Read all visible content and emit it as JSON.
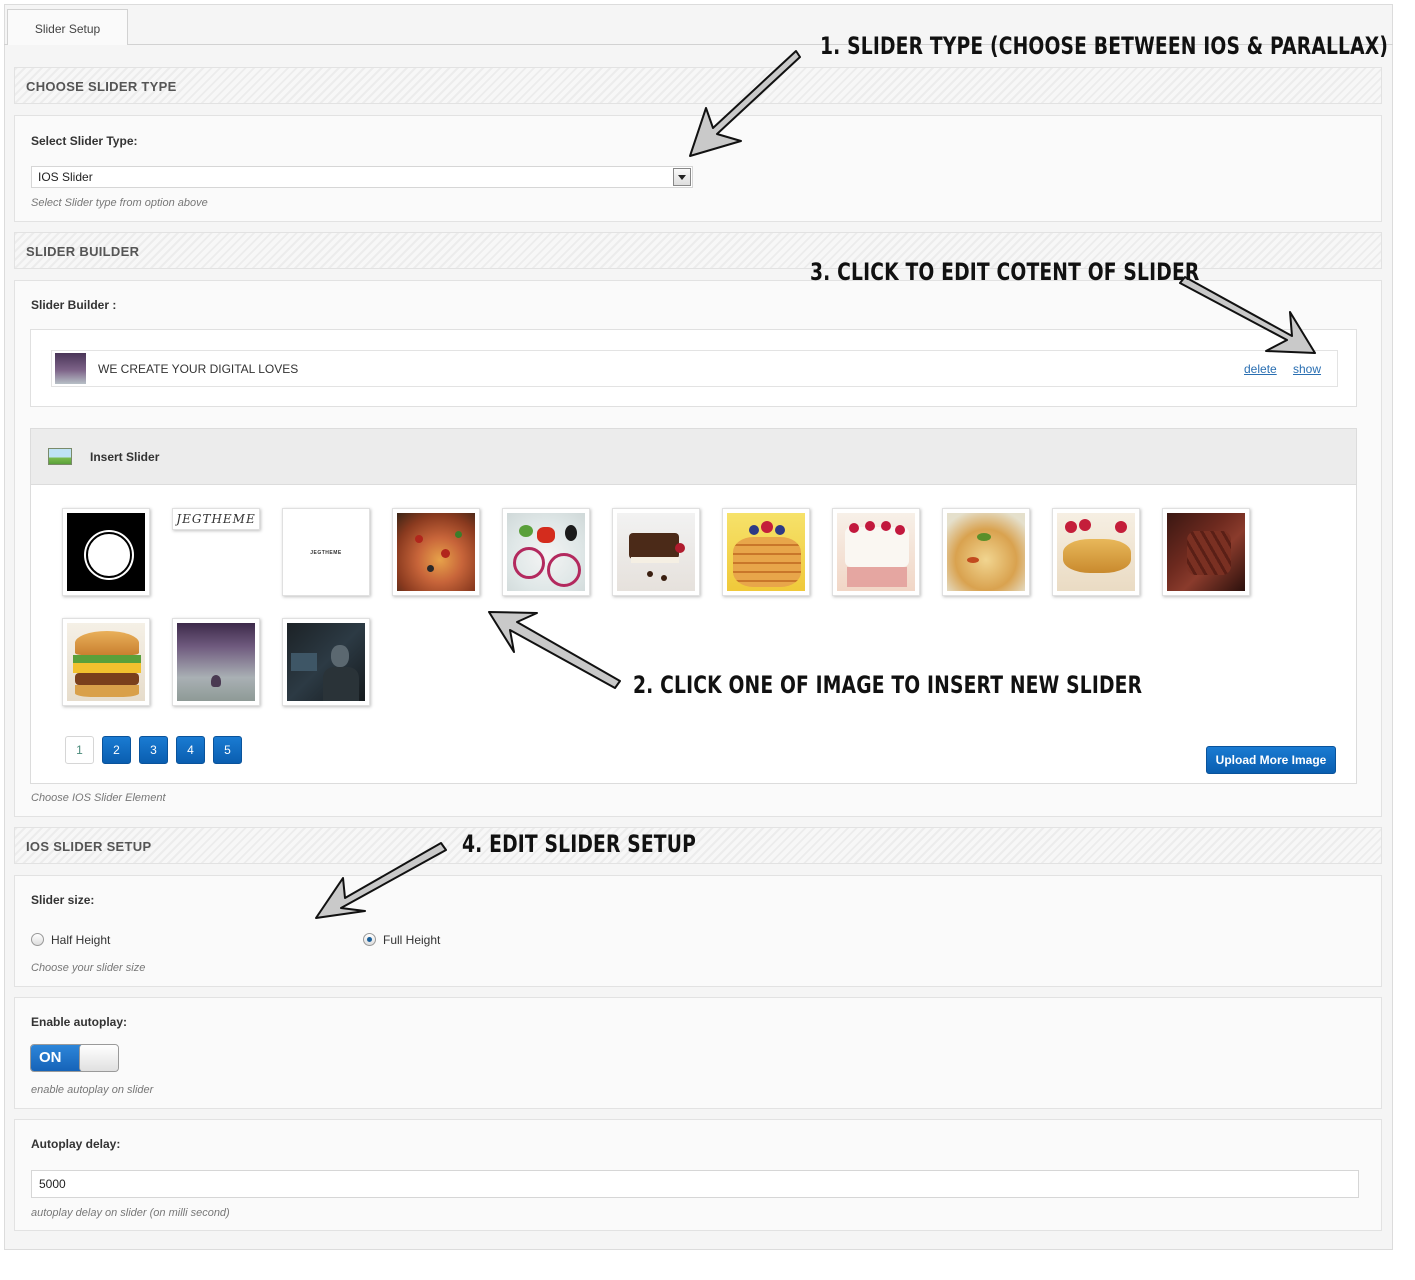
{
  "tabs": [
    "Slider Setup"
  ],
  "sections": {
    "choose_type": {
      "heading": "CHOOSE SLIDER TYPE",
      "label": "Select Slider Type:",
      "selected": "IOS Slider",
      "hint": "Select Slider type from option above"
    },
    "builder": {
      "heading": "SLIDER BUILDER",
      "label": "Slider Builder :",
      "slide_title": "WE CREATE YOUR DIGITAL LOVES",
      "delete_label": "delete",
      "show_label": "show",
      "insert_title": "Insert Slider",
      "thumbnails": [
        "black-circle-logo",
        "jegtheme-script-logo",
        "jegtheme-logo",
        "pizza",
        "salad",
        "chocolate-cake",
        "pancakes",
        "raspberry-cake",
        "pasta",
        "crepes",
        "steak",
        "burger",
        "purple-landscape",
        "man-at-computer"
      ],
      "thumb_text_1": "JEGTHEME",
      "thumb_text_2": "JEGTHEME",
      "pages": [
        "1",
        "2",
        "3",
        "4",
        "5"
      ],
      "current_page": "1",
      "upload_label": "Upload More Image",
      "hint": "Choose IOS Slider Element"
    },
    "ios_setup": {
      "heading": "IOS SLIDER SETUP",
      "size_label": "Slider size:",
      "half_label": "Half Height",
      "full_label": "Full Height",
      "selected_size": "Full Height",
      "size_hint": "Choose your slider size",
      "autoplay_label": "Enable autoplay:",
      "autoplay_state": "ON",
      "autoplay_hint": "enable autoplay on slider",
      "delay_label": "Autoplay delay:",
      "delay_value": "5000",
      "delay_hint": "autoplay delay on slider (on milli second)"
    }
  },
  "annotations": {
    "a1": "1. SLIDER TYPE (CHOOSE BETWEEN IOS & PARALLAX)",
    "a2": "2. CLICK ONE OF IMAGE TO INSERT NEW SLIDER",
    "a3": "3. CLICK TO EDIT COTENT OF SLIDER",
    "a4": "4. EDIT SLIDER SETUP"
  },
  "colors": {
    "accent_blue": "#0a5eb0",
    "link": "#2a6fb2",
    "page_bg": "#f5f5f5"
  }
}
